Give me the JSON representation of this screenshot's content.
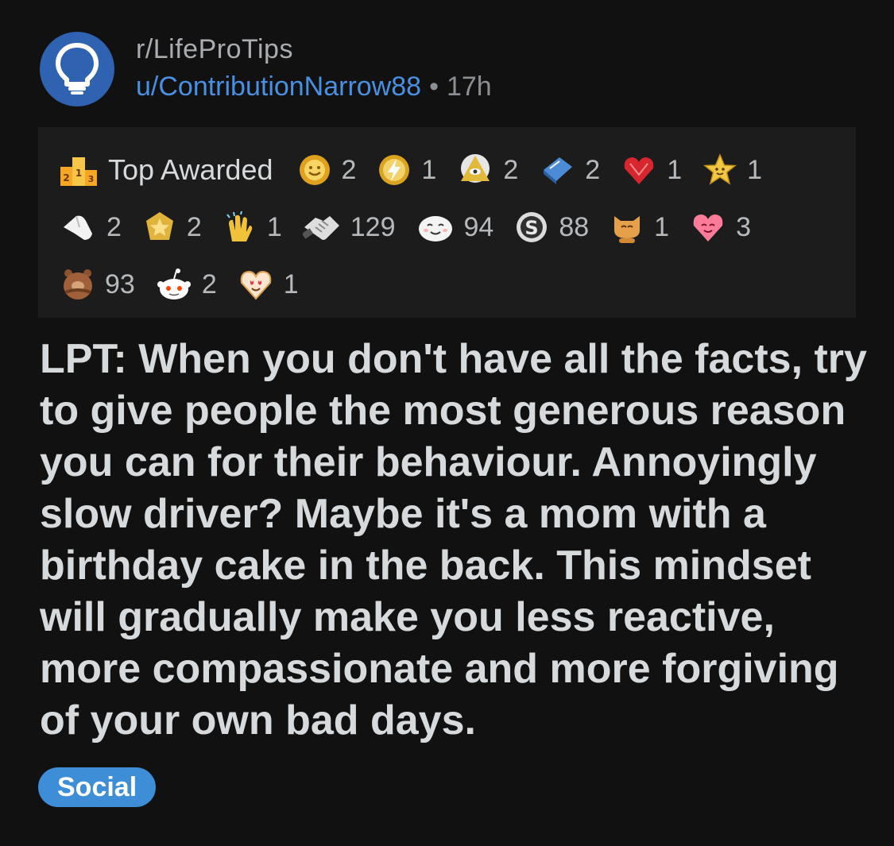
{
  "post": {
    "subreddit": "r/LifeProTips",
    "username": "u/ContributionNarrow88",
    "separator": "•",
    "age": "17h",
    "title": "LPT: When you don't have all the facts, try to give people the most generous reason you can for their behaviour. Annoyingly slow driver? Maybe it's a mom with a birthday cake in the back. This mindset will gradually make you less reactive, more compassionate and more forgiving of your own bad days.",
    "flair": "Social"
  },
  "awards": {
    "label": "Top Awarded",
    "items": [
      {
        "icon": "gold-sun-award-icon",
        "count": "2"
      },
      {
        "icon": "gold-bolt-award-icon",
        "count": "1"
      },
      {
        "icon": "pyramid-eye-award-icon",
        "count": "2"
      },
      {
        "icon": "book-award-icon",
        "count": "2"
      },
      {
        "icon": "gem-heart-award-icon",
        "count": "1"
      },
      {
        "icon": "smiling-star-award-icon",
        "count": "1"
      },
      {
        "icon": "hand-award-icon",
        "count": "2"
      },
      {
        "icon": "star-medal-award-icon",
        "count": "2"
      },
      {
        "icon": "clapping-hands-award-icon",
        "count": "1"
      },
      {
        "icon": "handshake-award-icon",
        "count": "129"
      },
      {
        "icon": "wholesome-face-award-icon",
        "count": "94"
      },
      {
        "icon": "silver-award-icon",
        "count": "88"
      },
      {
        "icon": "cat-award-icon",
        "count": "1"
      },
      {
        "icon": "hugging-heart-award-icon",
        "count": "3"
      },
      {
        "icon": "bear-hug-award-icon",
        "count": "93"
      },
      {
        "icon": "snoo-award-icon",
        "count": "2"
      },
      {
        "icon": "heart-eyes-award-icon",
        "count": "1"
      }
    ]
  },
  "colors": {
    "background": "#111111",
    "panel": "#1c1c1d",
    "username": "#4a90e2",
    "avatar": "#2f62b0",
    "flair": "#3d8ed6"
  }
}
